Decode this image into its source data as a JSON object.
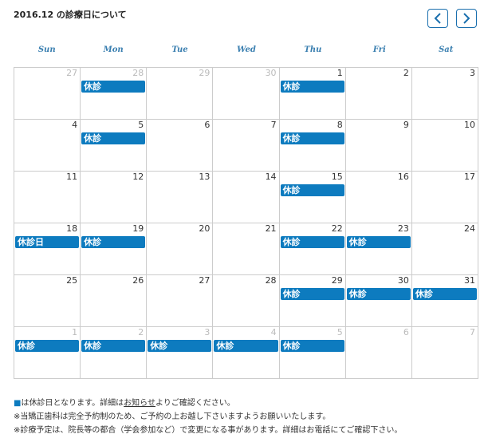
{
  "title": "2016.12 の診療日について",
  "nav": {
    "prev_icon": "chevron-left-icon",
    "next_icon": "chevron-right-icon"
  },
  "weekdays": [
    "Sun",
    "Mon",
    "Tue",
    "Wed",
    "Thu",
    "Fri",
    "Sat"
  ],
  "weeks": [
    [
      {
        "day": "27",
        "other": true,
        "label": ""
      },
      {
        "day": "28",
        "other": true,
        "label": "休診"
      },
      {
        "day": "29",
        "other": true,
        "label": ""
      },
      {
        "day": "30",
        "other": true,
        "label": ""
      },
      {
        "day": "1",
        "other": false,
        "label": "休診"
      },
      {
        "day": "2",
        "other": false,
        "label": ""
      },
      {
        "day": "3",
        "other": false,
        "label": ""
      }
    ],
    [
      {
        "day": "4",
        "other": false,
        "label": ""
      },
      {
        "day": "5",
        "other": false,
        "label": "休診"
      },
      {
        "day": "6",
        "other": false,
        "label": ""
      },
      {
        "day": "7",
        "other": false,
        "label": ""
      },
      {
        "day": "8",
        "other": false,
        "label": "休診"
      },
      {
        "day": "9",
        "other": false,
        "label": ""
      },
      {
        "day": "10",
        "other": false,
        "label": ""
      }
    ],
    [
      {
        "day": "11",
        "other": false,
        "label": ""
      },
      {
        "day": "12",
        "other": false,
        "label": ""
      },
      {
        "day": "13",
        "other": false,
        "label": ""
      },
      {
        "day": "14",
        "other": false,
        "label": ""
      },
      {
        "day": "15",
        "other": false,
        "label": "休診"
      },
      {
        "day": "16",
        "other": false,
        "label": ""
      },
      {
        "day": "17",
        "other": false,
        "label": ""
      }
    ],
    [
      {
        "day": "18",
        "other": false,
        "label": "休診日"
      },
      {
        "day": "19",
        "other": false,
        "label": "休診"
      },
      {
        "day": "20",
        "other": false,
        "label": ""
      },
      {
        "day": "21",
        "other": false,
        "label": ""
      },
      {
        "day": "22",
        "other": false,
        "label": "休診"
      },
      {
        "day": "23",
        "other": false,
        "label": "休診"
      },
      {
        "day": "24",
        "other": false,
        "label": ""
      }
    ],
    [
      {
        "day": "25",
        "other": false,
        "label": ""
      },
      {
        "day": "26",
        "other": false,
        "label": ""
      },
      {
        "day": "27",
        "other": false,
        "label": ""
      },
      {
        "day": "28",
        "other": false,
        "label": ""
      },
      {
        "day": "29",
        "other": false,
        "label": "休診"
      },
      {
        "day": "30",
        "other": false,
        "label": "休診"
      },
      {
        "day": "31",
        "other": false,
        "label": "休診"
      }
    ],
    [
      {
        "day": "1",
        "other": true,
        "label": "休診"
      },
      {
        "day": "2",
        "other": true,
        "label": "休診"
      },
      {
        "day": "3",
        "other": true,
        "label": "休診"
      },
      {
        "day": "4",
        "other": true,
        "label": "休診"
      },
      {
        "day": "5",
        "other": true,
        "label": "休診"
      },
      {
        "day": "6",
        "other": true,
        "label": ""
      },
      {
        "day": "7",
        "other": true,
        "label": ""
      }
    ]
  ],
  "notes": {
    "line1_square": "■",
    "line1_pre": "は休診日となります。詳細は",
    "line1_link": "お知らせ",
    "line1_post": "よりご確認ください。",
    "line2": "※当矯正歯科は完全予約制のため、ご予約の上お越し下さいますようお願いいたします。",
    "line3": "※診療予定は、院長等の都合（学会参加など）で変更になる事があります。詳細はお電話にてご確認下さい。"
  },
  "colors": {
    "closed": "#0d7bbf",
    "weekday_header": "#3a7fb0",
    "nav_border": "#1a6fae"
  }
}
